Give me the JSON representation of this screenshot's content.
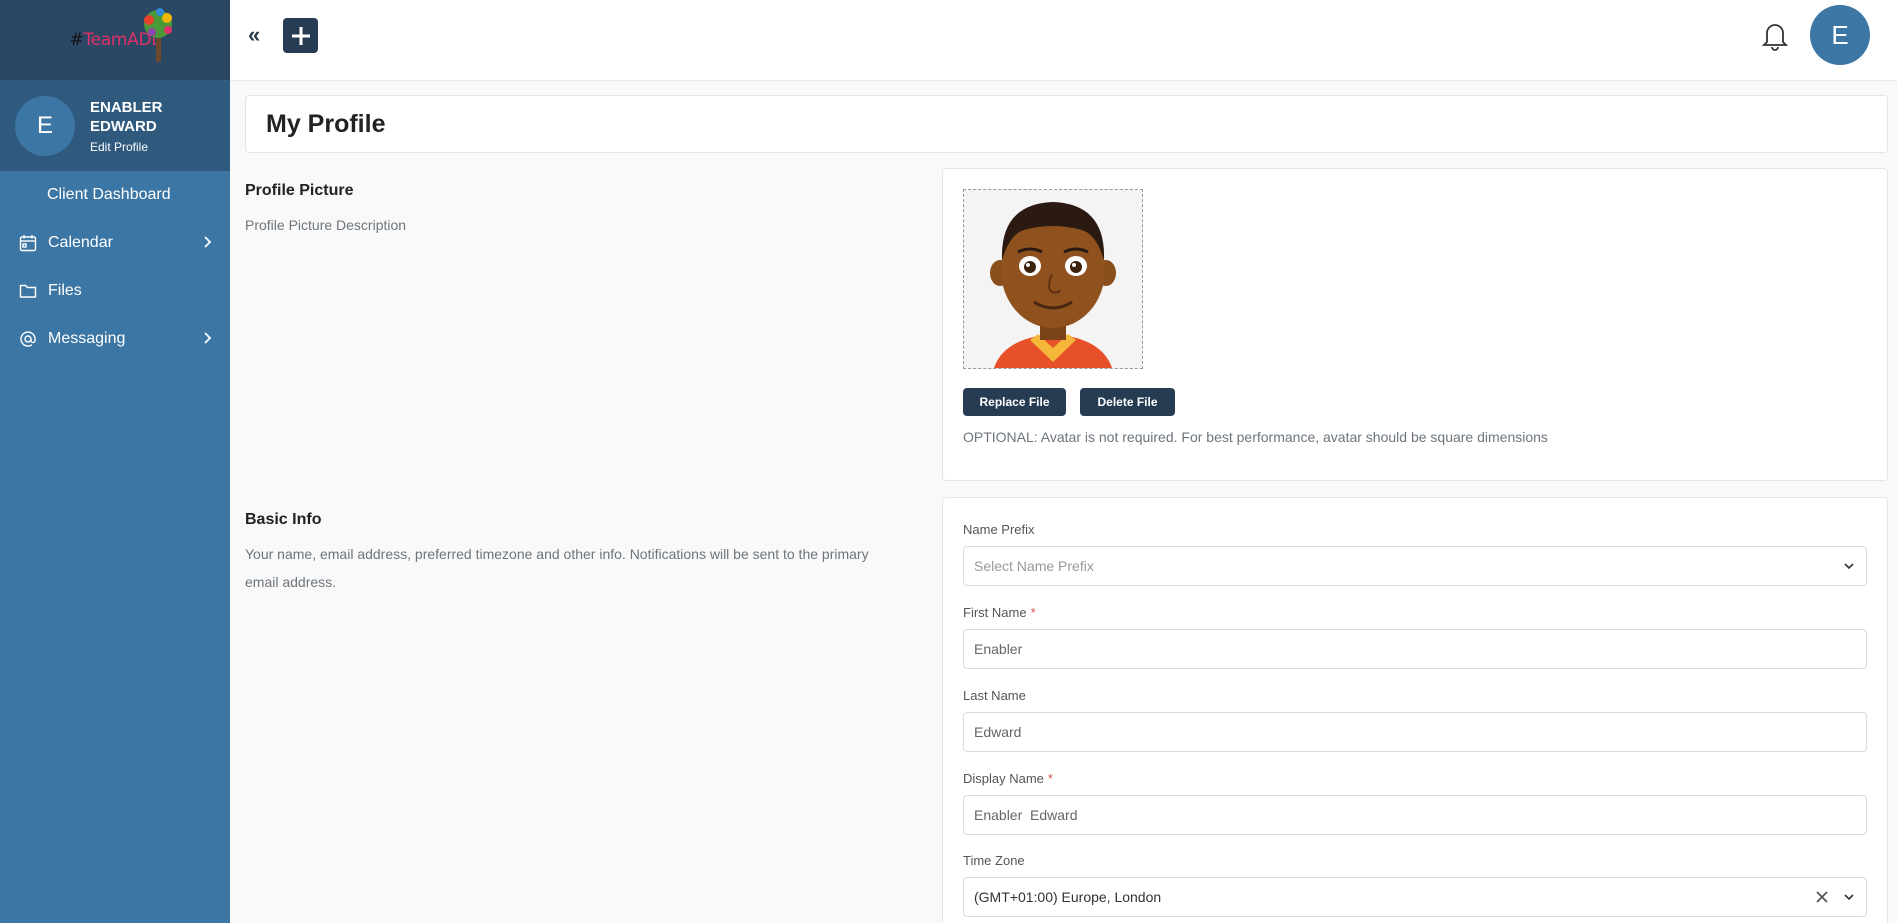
{
  "logo": {
    "hash": "#",
    "name": "TeamADL"
  },
  "user": {
    "initial": "E",
    "name": "ENABLER EDWARD",
    "edit_label": "Edit Profile"
  },
  "nav": [
    {
      "label": "Client Dashboard",
      "icon": "",
      "has_children": false
    },
    {
      "label": "Calendar",
      "icon": "calendar-icon",
      "has_children": true
    },
    {
      "label": "Files",
      "icon": "folder-icon",
      "has_children": false
    },
    {
      "label": "Messaging",
      "icon": "at-icon",
      "has_children": true
    }
  ],
  "header": {
    "collapse_glyph": "«",
    "add_icon": "plus-icon",
    "bell_icon": "bell-icon",
    "avatar_initial": "E"
  },
  "page": {
    "title": "My Profile"
  },
  "profile_picture": {
    "title": "Profile Picture",
    "description": "Profile Picture Description",
    "replace_label": "Replace File",
    "delete_label": "Delete File",
    "note": "OPTIONAL: Avatar is not required. For best performance, avatar should be square dimensions"
  },
  "basic_info": {
    "title": "Basic Info",
    "description": "Your name, email address, preferred timezone and other info. Notifications will be sent to the primary email address.",
    "fields": {
      "name_prefix": {
        "label": "Name Prefix",
        "placeholder": "Select Name Prefix"
      },
      "first_name": {
        "label": "First Name",
        "required": "*",
        "value": "Enabler"
      },
      "last_name": {
        "label": "Last Name",
        "value": "Edward"
      },
      "display_name": {
        "label": "Display Name",
        "required": "*",
        "value": "Enabler  Edward"
      },
      "time_zone": {
        "label": "Time Zone",
        "value": "(GMT+01:00) Europe, London"
      }
    }
  },
  "colors": {
    "sidebar": "#3c76a4",
    "sidebar_dark": "#2a4864",
    "button": "#263c52",
    "required": "#d9534f"
  }
}
